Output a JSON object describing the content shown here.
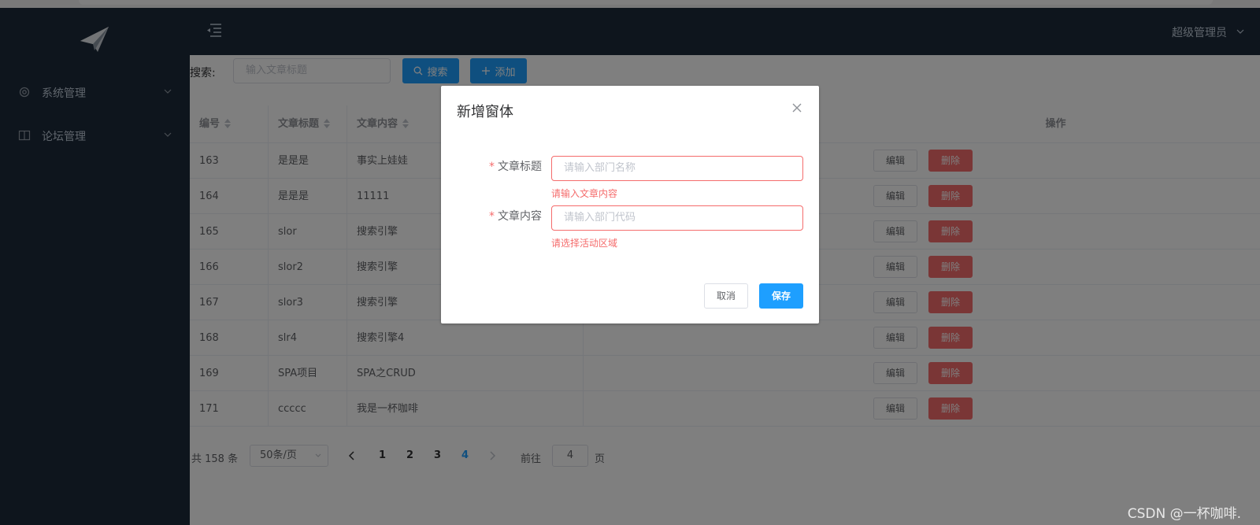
{
  "header": {
    "user_name": "超级管理员"
  },
  "sidebar": {
    "items": [
      {
        "label": "系统管理",
        "icon": "gear-icon"
      },
      {
        "label": "论坛管理",
        "icon": "book-icon"
      }
    ]
  },
  "toolbar": {
    "search_label": "搜索:",
    "search_placeholder": "输入文章标题",
    "search_button": "搜索",
    "add_button": "添加"
  },
  "table": {
    "columns": [
      "编号",
      "文章标题",
      "文章内容",
      "操作"
    ],
    "rows": [
      {
        "id": "163",
        "title": "是是是",
        "content": "事实上娃娃"
      },
      {
        "id": "164",
        "title": "是是是",
        "content": "11111"
      },
      {
        "id": "165",
        "title": "slor",
        "content": "搜索引擎"
      },
      {
        "id": "166",
        "title": "slor2",
        "content": "搜索引擎"
      },
      {
        "id": "167",
        "title": "slor3",
        "content": "搜索引擎"
      },
      {
        "id": "168",
        "title": "slr4",
        "content": "搜索引擎4"
      },
      {
        "id": "169",
        "title": "SPA项目",
        "content": "SPA之CRUD"
      },
      {
        "id": "171",
        "title": "ccccc",
        "content": "我是一杯咖啡"
      }
    ],
    "edit_label": "编辑",
    "delete_label": "删除"
  },
  "pagination": {
    "total": "共 158 条",
    "page_size": "50条/页",
    "pages": [
      "1",
      "2",
      "3",
      "4"
    ],
    "current_page": "4",
    "goto_label": "前往",
    "goto_value": "4",
    "page_suffix": "页"
  },
  "dialog": {
    "title": "新增窗体",
    "fields": [
      {
        "label": "文章标题",
        "placeholder": "请输入部门名称",
        "error": "请输入文章内容"
      },
      {
        "label": "文章内容",
        "placeholder": "请输入部门代码",
        "error": "请选择活动区域"
      }
    ],
    "required_mark": "*",
    "cancel_label": "取消",
    "save_label": "保存"
  },
  "watermark": "CSDN @一杯咖啡.",
  "colors": {
    "primary": "#1e9fff",
    "danger": "#f56c6c",
    "sidebar": "#1d2b3a"
  }
}
